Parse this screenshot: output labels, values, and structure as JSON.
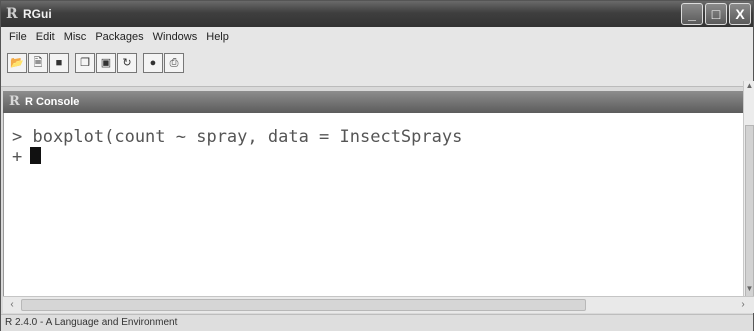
{
  "window": {
    "title": "RGui",
    "app_icon": "R",
    "controls": [
      "_",
      "□",
      "X"
    ]
  },
  "menu": [
    "File",
    "Edit",
    "Misc",
    "Packages",
    "Windows",
    "Help"
  ],
  "toolbar": {
    "group1": [
      "open-script-icon",
      "load-workspace-icon",
      "save-workspace-icon"
    ],
    "group2": [
      "copy-icon",
      "paste-icon",
      "copy-paste-icon"
    ],
    "group3": [
      "stop-icon",
      "print-icon"
    ]
  },
  "console": {
    "title": "R Console",
    "icon": "R",
    "line1": "> boxplot(count ~ spray, data = InsectSprays",
    "line2_prompt": "+"
  },
  "status": {
    "text": "R 2.4.0 - A Language and Environment"
  }
}
